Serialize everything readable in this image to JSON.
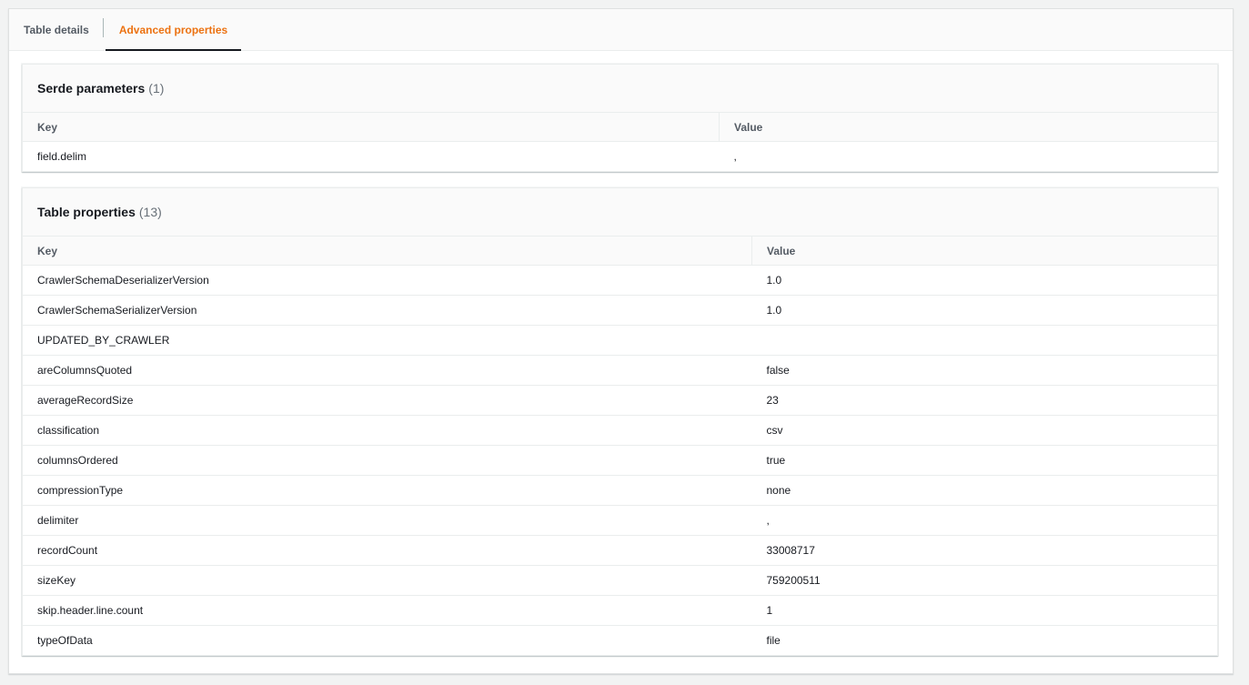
{
  "tabs": [
    {
      "label": "Table details"
    },
    {
      "label": "Advanced properties"
    }
  ],
  "serde": {
    "title": "Serde parameters",
    "count": "(1)",
    "key_header": "Key",
    "value_header": "Value",
    "rows": [
      {
        "key": "field.delim",
        "value": ","
      }
    ]
  },
  "props": {
    "title": "Table properties",
    "count": "(13)",
    "key_header": "Key",
    "value_header": "Value",
    "rows": [
      {
        "key": "CrawlerSchemaDeserializerVersion",
        "value": "1.0"
      },
      {
        "key": "CrawlerSchemaSerializerVersion",
        "value": "1.0"
      },
      {
        "key": "UPDATED_BY_CRAWLER",
        "value": ""
      },
      {
        "key": "areColumnsQuoted",
        "value": "false"
      },
      {
        "key": "averageRecordSize",
        "value": "23"
      },
      {
        "key": "classification",
        "value": "csv"
      },
      {
        "key": "columnsOrdered",
        "value": "true"
      },
      {
        "key": "compressionType",
        "value": "none"
      },
      {
        "key": "delimiter",
        "value": ","
      },
      {
        "key": "recordCount",
        "value": "33008717"
      },
      {
        "key": "sizeKey",
        "value": "759200511"
      },
      {
        "key": "skip.header.line.count",
        "value": "1"
      },
      {
        "key": "typeOfData",
        "value": "file"
      }
    ]
  },
  "colors": {
    "accent": "#ec7211",
    "text": "#16191f",
    "muted": "#545b64"
  }
}
